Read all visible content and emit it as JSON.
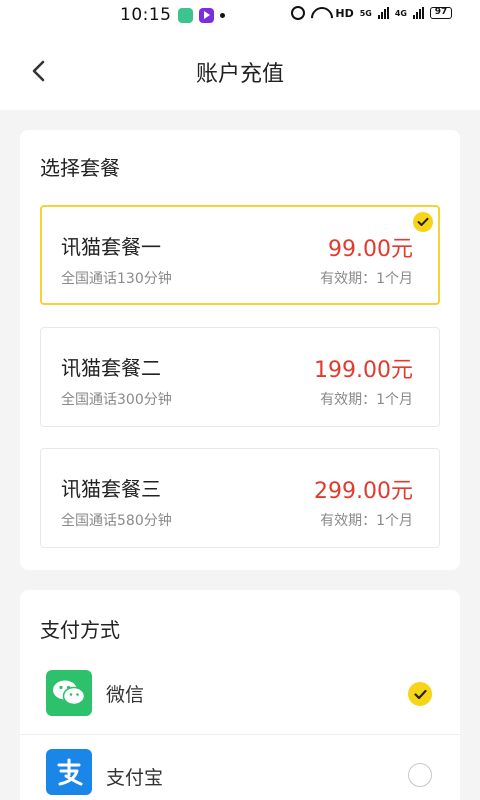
{
  "status_bar": {
    "time": "10:15",
    "network_label": "HD",
    "network_5g": "5G",
    "network_4g": "4G",
    "battery": "97"
  },
  "header": {
    "title": "账户充值"
  },
  "packages": {
    "section_title": "选择套餐",
    "items": [
      {
        "name": "讯猫套餐一",
        "desc": "全国通话130分钟",
        "price": "99.00元",
        "validity": "有效期：1个月",
        "selected": true
      },
      {
        "name": "讯猫套餐二",
        "desc": "全国通话300分钟",
        "price": "199.00元",
        "validity": "有效期：1个月",
        "selected": false
      },
      {
        "name": "讯猫套餐三",
        "desc": "全国通话580分钟",
        "price": "299.00元",
        "validity": "有效期：1个月",
        "selected": false
      }
    ]
  },
  "payment": {
    "section_title": "支付方式",
    "methods": [
      {
        "label": "微信",
        "icon": "wechat-icon",
        "selected": true
      },
      {
        "label": "支付宝",
        "icon": "alipay-icon",
        "selected": false
      }
    ]
  },
  "colors": {
    "accent": "#f7d417",
    "price": "#e23b2e",
    "wechat": "#2dc16b",
    "alipay": "#1a86e8"
  }
}
